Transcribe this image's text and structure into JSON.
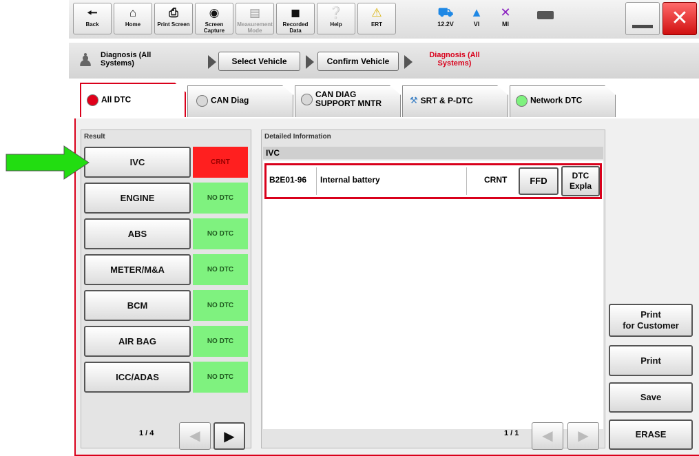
{
  "toolbar": {
    "back": "Back",
    "home": "Home",
    "print_screen": "Print Screen",
    "screen_capture": "Screen Capture",
    "measurement_mode": "Measurement Mode",
    "recorded_data": "Recorded Data",
    "help": "Help",
    "ert": "ERT",
    "voltage": "12.2V",
    "vi": "VI",
    "mi": "MI"
  },
  "breadcrumb": {
    "current_title": "Diagnosis (All Systems)",
    "select_vehicle": "Select Vehicle",
    "confirm_vehicle": "Confirm Vehicle",
    "active_step": "Diagnosis (All Systems)"
  },
  "tabs": [
    {
      "label": "All DTC",
      "dot_color": "#e0001a"
    },
    {
      "label": "CAN Diag",
      "dot_color": "#d8d8d8"
    },
    {
      "label": "CAN DIAG SUPPORT MNTR",
      "dot_color": "#d8d8d8"
    },
    {
      "label": "SRT & P-DTC",
      "dot_color": ""
    },
    {
      "label": "Network DTC",
      "dot_color": "#7ff27f"
    }
  ],
  "result": {
    "title": "Result",
    "systems": [
      {
        "name": "IVC",
        "status": "CRNT"
      },
      {
        "name": "ENGINE",
        "status": "NO DTC"
      },
      {
        "name": "ABS",
        "status": "NO DTC"
      },
      {
        "name": "METER/M&A",
        "status": "NO DTC"
      },
      {
        "name": "BCM",
        "status": "NO DTC"
      },
      {
        "name": "AIR BAG",
        "status": "NO DTC"
      },
      {
        "name": "ICC/ADAS",
        "status": "NO DTC"
      }
    ],
    "page": "1 / 4"
  },
  "detail": {
    "title": "Detailed Information",
    "system": "IVC",
    "dtc_code": "B2E01-96",
    "dtc_desc": "Internal battery",
    "dtc_status": "CRNT",
    "ffd": "FFD",
    "dtc_expla_1": "DTC",
    "dtc_expla_2": "Expla",
    "page": "1 / 1"
  },
  "side": {
    "print_customer_1": "Print",
    "print_customer_2": "for Customer",
    "print": "Print",
    "save": "Save",
    "erase": "ERASE"
  },
  "colors": {
    "accent_red": "#d9001b",
    "crnt_bg": "#ff1f1f",
    "nodtc_bg": "#7ff27f",
    "pointer_arrow": "#22dd11"
  }
}
